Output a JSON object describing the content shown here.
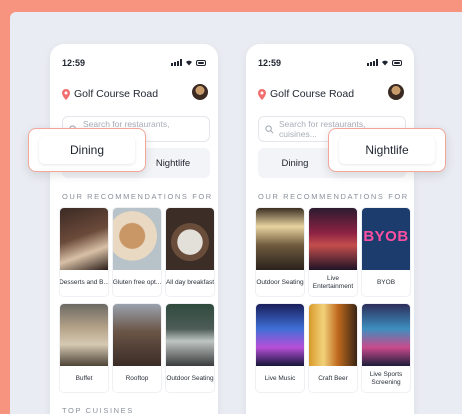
{
  "status": {
    "time": "12:59"
  },
  "location": "Golf Course Road",
  "search": {
    "placeholder": "Search for restaurants, cuisines..."
  },
  "tabs": {
    "dining": "Dining",
    "nightlife": "Nightlife"
  },
  "recommendations_title": "OUR RECOMMENDATIONS FOR",
  "top_cuisines_title": "TOP CUISINES",
  "dining_cards": [
    {
      "label": "Desserts and B..."
    },
    {
      "label": "Gluten free opt..."
    },
    {
      "label": "All day breakfast"
    },
    {
      "label": "Buffet"
    },
    {
      "label": "Rooftop"
    },
    {
      "label": "Outdoor Seating"
    }
  ],
  "nightlife_cards": [
    {
      "label": "Outdoor Seating"
    },
    {
      "label": "Live Entertainment"
    },
    {
      "label": "BYOB"
    },
    {
      "label": "Live Music"
    },
    {
      "label": "Craft Beer"
    },
    {
      "label": "Live Sports Screening"
    }
  ],
  "byob_sign": "BYOB",
  "colors": {
    "background": "#f7947f",
    "canvas": "#e9ecf2",
    "pin": "#f26d6d"
  }
}
